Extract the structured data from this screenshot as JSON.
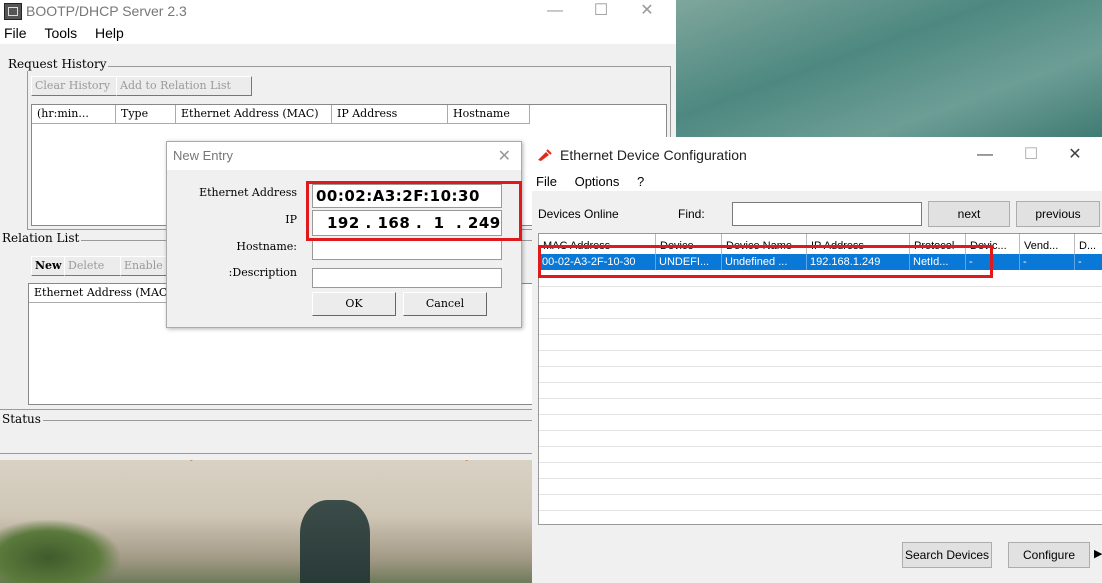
{
  "bootp": {
    "title": "BOOTP/DHCP Server 2.3",
    "menu": [
      "File",
      "Tools",
      "Help"
    ],
    "request_history": {
      "label": "Request History",
      "buttons": [
        "Clear History",
        "Add to Relation List"
      ],
      "columns": [
        "(hr:min...",
        "Type",
        "Ethernet Address (MAC)",
        "IP Address",
        "Hostname"
      ]
    },
    "relation_list": {
      "label": "Relation List",
      "buttons": [
        "New",
        "Delete",
        "Enable"
      ],
      "columns": [
        "Ethernet Address (MAC)"
      ]
    },
    "status": {
      "label": "Status"
    }
  },
  "new_entry": {
    "title": "New Entry",
    "ethernet_label": "Ethernet Address",
    "ethernet_value": "00:02:A3:2F:10:30",
    "ip_label": "IP",
    "ip_value": "192 . 168 .  1  . 249",
    "hostname_label": "Hostname:",
    "description_label": "Description:",
    "ok": "OK",
    "cancel": "Cancel"
  },
  "edc": {
    "title": "Ethernet Device Configuration",
    "menu": [
      "File",
      "Options",
      "?"
    ],
    "devices_online": "Devices Online",
    "find_label": "Find:",
    "find_value": "",
    "next": "next",
    "previous": "previous",
    "columns": [
      "MAC Address",
      "Device",
      "Device Name",
      "IP Address",
      "Protocol",
      "Devic...",
      "Vend...",
      "D..."
    ],
    "row": [
      "00-02-A3-2F-10-30",
      "UNDEFI...",
      "Undefined ...",
      "192.168.1.249",
      "NetId...",
      "-",
      "-",
      "-"
    ],
    "search_devices": "Search Devices",
    "configure": "Configure"
  },
  "colors": {
    "highlight": "#e0191d",
    "selection": "#0a78d7"
  }
}
